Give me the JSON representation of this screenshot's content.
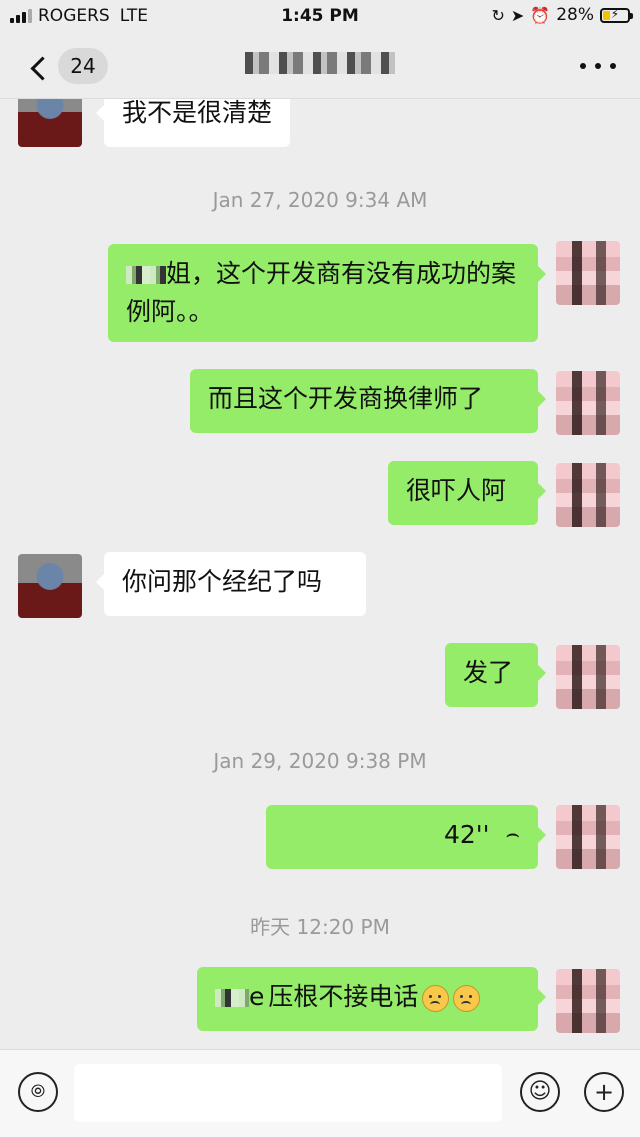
{
  "status_bar": {
    "carrier": "ROGERS",
    "network": "LTE",
    "time": "1:45 PM",
    "battery_percent_label": "28%",
    "battery_level": 0.28
  },
  "nav": {
    "unread_count": "24",
    "title": "S…0"
  },
  "messages": {
    "m1": {
      "sender": "contact",
      "text": "我不是很清楚"
    },
    "ts1": "Jan 27, 2020 9:34 AM",
    "m2": {
      "sender": "me",
      "text_after_name": "姐，这个开发商有没有成功的案例阿。。"
    },
    "m3": {
      "sender": "me",
      "text": "而且这个开发商换律师了"
    },
    "m4": {
      "sender": "me",
      "text": "很吓人阿"
    },
    "m5": {
      "sender": "contact",
      "text": "你问那个经纪了吗"
    },
    "m6": {
      "sender": "me",
      "text": "发了"
    },
    "ts2": "Jan 29, 2020 9:38 PM",
    "m7": {
      "sender": "me",
      "type": "voice",
      "duration": "42''"
    },
    "ts3": "昨天 12:20 PM",
    "m8": {
      "sender": "me",
      "text_prefix": "e",
      "text": "压根不接电话"
    }
  },
  "icons": {
    "back": "chevron-left-icon",
    "more": "ellipsis-icon",
    "voice_input": "voice-mode-icon",
    "emoji": "emoji-icon",
    "add": "plus-icon",
    "location": "location-arrow-icon",
    "alarm": "alarm-icon",
    "orientation_lock": "orientation-lock-icon"
  },
  "colors": {
    "outgoing_bubble": "#95ec69",
    "incoming_bubble": "#ffffff",
    "background": "#ededed"
  }
}
